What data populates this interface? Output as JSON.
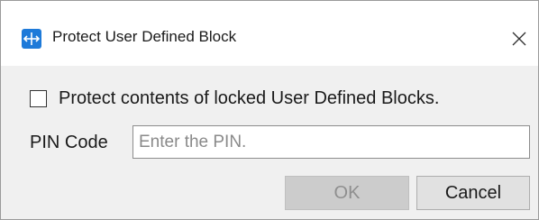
{
  "dialog": {
    "title": "Protect User Defined Block",
    "app_icon": "protect-block-icon",
    "close_icon": "close-icon"
  },
  "protect_option": {
    "label": "Protect contents of locked User Defined Blocks.",
    "checked": false
  },
  "pin": {
    "label": "PIN Code",
    "value": "",
    "placeholder": "Enter the PIN."
  },
  "buttons": {
    "ok_label": "OK",
    "ok_enabled": false,
    "cancel_label": "Cancel"
  },
  "colors": {
    "accent": "#1e7ad9",
    "dialog_background": "#f0f0f0",
    "disabled_button": "#cccccc"
  }
}
